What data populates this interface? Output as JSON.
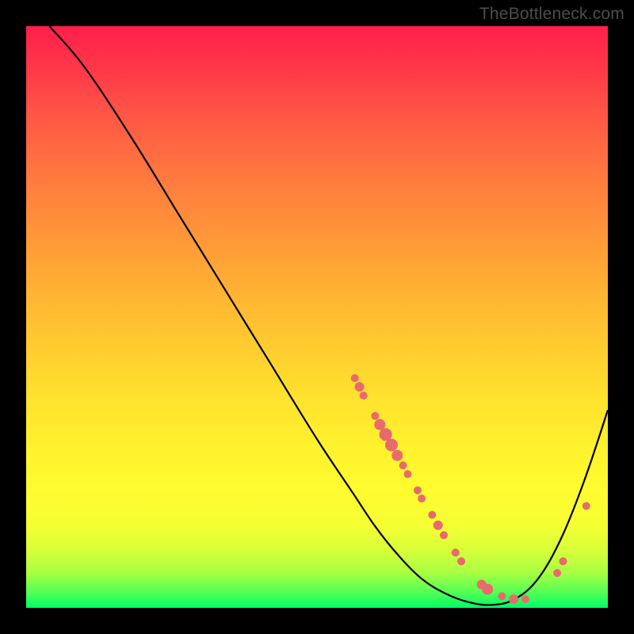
{
  "watermark": "TheBottleneck.com",
  "chart_data": {
    "type": "line",
    "title": "",
    "xlabel": "",
    "ylabel": "",
    "xlim": [
      0,
      100
    ],
    "ylim": [
      0,
      100
    ],
    "series": [
      {
        "name": "curve",
        "x": [
          4,
          10,
          18,
          26,
          34,
          42,
          50,
          56,
          60,
          64,
          68,
          72,
          76,
          80,
          84,
          88,
          92,
          96,
          100
        ],
        "y": [
          100,
          93,
          81,
          68,
          55,
          42,
          29,
          20,
          14,
          9,
          5,
          2.5,
          1,
          0.5,
          1.5,
          5,
          12,
          22,
          34
        ]
      }
    ],
    "markers": [
      {
        "x": 56.5,
        "y": 39.5,
        "r": 5
      },
      {
        "x": 57.3,
        "y": 38.0,
        "r": 6
      },
      {
        "x": 58.0,
        "y": 36.5,
        "r": 5
      },
      {
        "x": 60.0,
        "y": 33.0,
        "r": 5
      },
      {
        "x": 60.8,
        "y": 31.5,
        "r": 7
      },
      {
        "x": 61.8,
        "y": 29.8,
        "r": 8
      },
      {
        "x": 62.8,
        "y": 28.0,
        "r": 8
      },
      {
        "x": 63.8,
        "y": 26.2,
        "r": 7
      },
      {
        "x": 64.8,
        "y": 24.5,
        "r": 5
      },
      {
        "x": 65.6,
        "y": 23.0,
        "r": 5
      },
      {
        "x": 67.3,
        "y": 20.2,
        "r": 5
      },
      {
        "x": 68.0,
        "y": 18.8,
        "r": 5
      },
      {
        "x": 69.8,
        "y": 16.0,
        "r": 5
      },
      {
        "x": 70.8,
        "y": 14.2,
        "r": 6
      },
      {
        "x": 71.8,
        "y": 12.5,
        "r": 5
      },
      {
        "x": 73.8,
        "y": 9.5,
        "r": 5
      },
      {
        "x": 74.8,
        "y": 8.0,
        "r": 5
      },
      {
        "x": 78.3,
        "y": 4.0,
        "r": 6
      },
      {
        "x": 79.3,
        "y": 3.2,
        "r": 7
      },
      {
        "x": 81.8,
        "y": 2.0,
        "r": 5
      },
      {
        "x": 83.8,
        "y": 1.5,
        "r": 6
      },
      {
        "x": 85.8,
        "y": 1.5,
        "r": 5
      },
      {
        "x": 91.3,
        "y": 6.0,
        "r": 5
      },
      {
        "x": 92.3,
        "y": 8.0,
        "r": 5
      },
      {
        "x": 96.3,
        "y": 17.5,
        "r": 5
      }
    ]
  }
}
